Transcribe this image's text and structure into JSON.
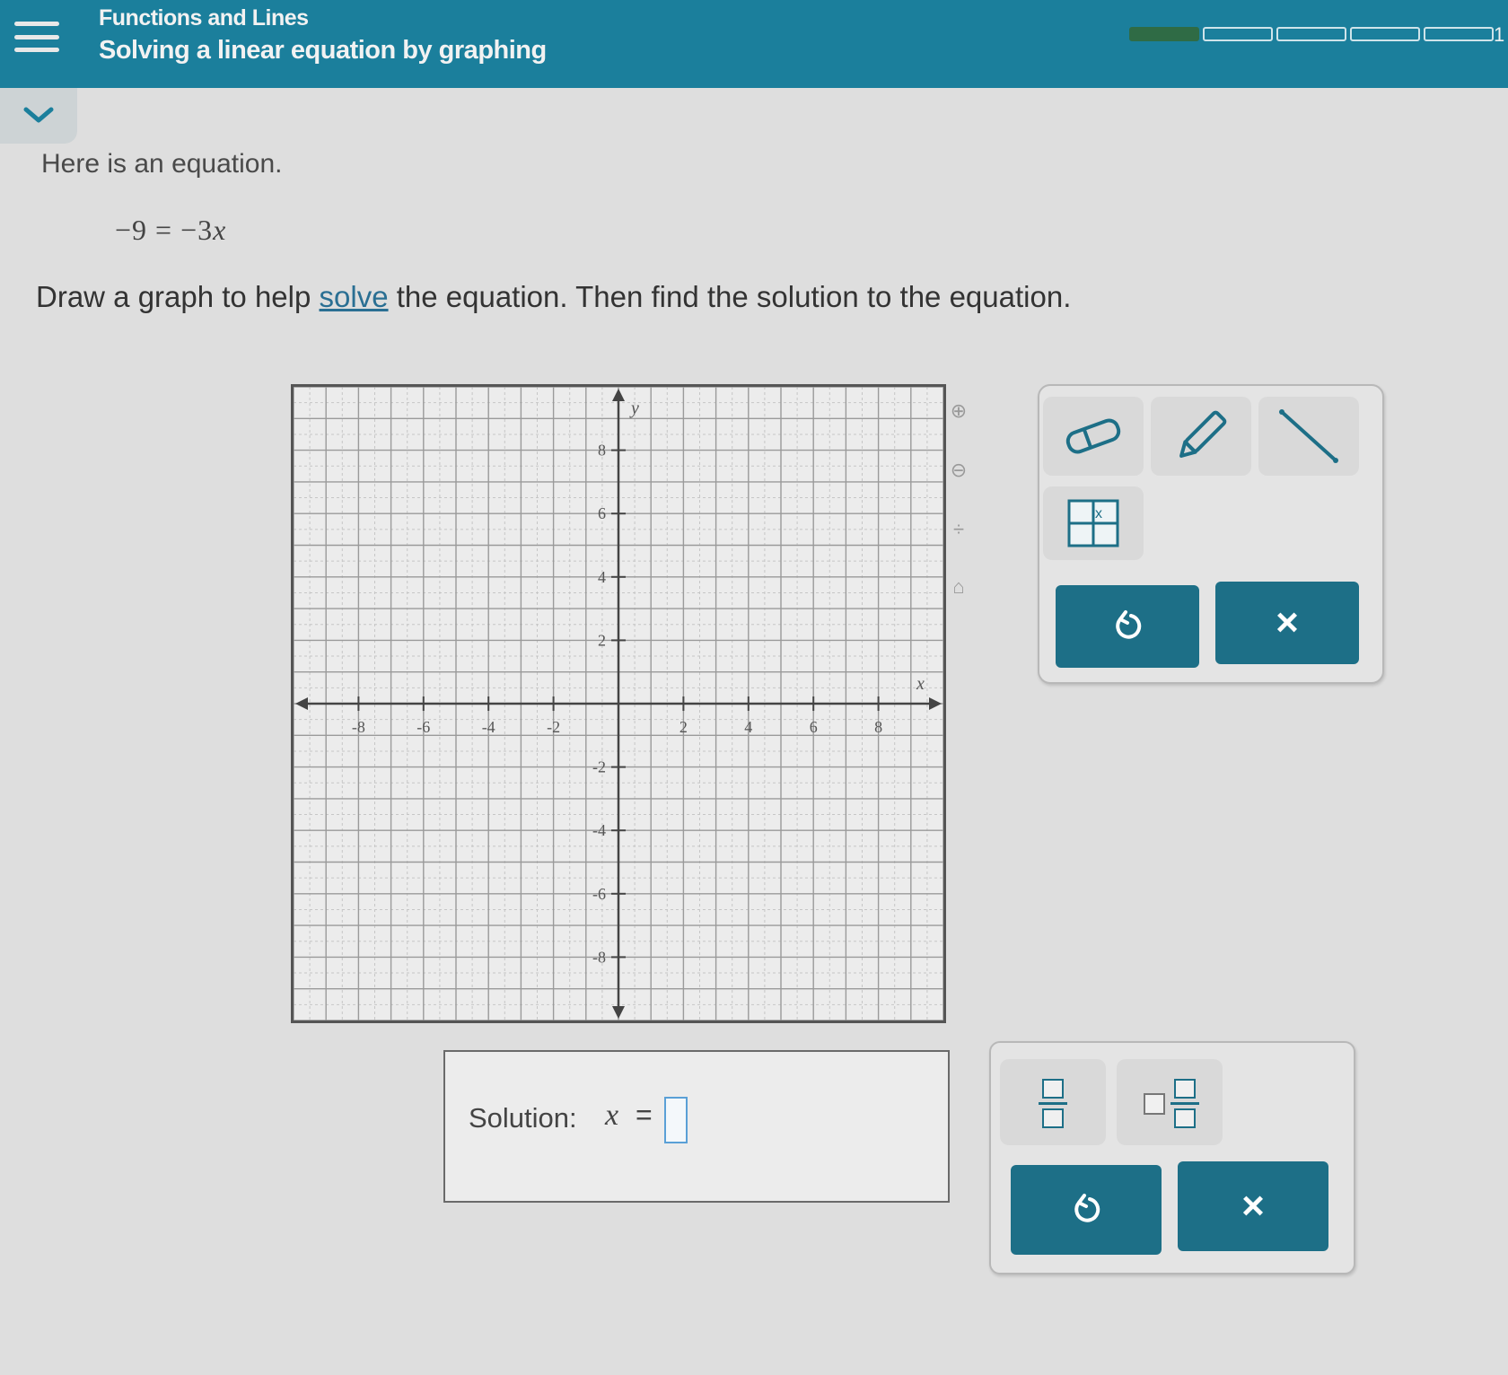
{
  "header": {
    "topic": "Functions and Lines",
    "lesson": "Solving a linear equation by graphing",
    "progress": {
      "segments": 5,
      "filled_fraction": 0.5
    },
    "progress_count": "1"
  },
  "problem": {
    "intro": "Here is an equation.",
    "equation": {
      "left": "−9",
      "equals": "=",
      "right_coef": "−3",
      "right_var": "x"
    },
    "instruction_before": "Draw a graph to help ",
    "instruction_link": "solve",
    "instruction_after": " the equation. Then find the solution to the equation."
  },
  "graph": {
    "x_label": "x",
    "y_label": "y",
    "x_ticks": [
      "-8",
      "-6",
      "-4",
      "-2",
      "2",
      "4",
      "6",
      "8"
    ],
    "y_ticks": [
      "8",
      "6",
      "4",
      "2",
      "-2",
      "-4",
      "-6",
      "-8"
    ],
    "range": [
      -10,
      10
    ]
  },
  "graph_tools": {
    "icons": [
      "zoom-in-icon",
      "zoom-out-icon",
      "fit-icon",
      "home-icon"
    ],
    "eraser": "eraser-icon",
    "pencil": "pencil-icon",
    "line": "line-segment-icon",
    "table": "table-icon",
    "undo": "undo-icon",
    "clear": "×"
  },
  "answer": {
    "label": "Solution:",
    "variable": "x",
    "equals": "=",
    "value": ""
  },
  "fraction_tools": {
    "fraction": "fraction-icon",
    "mixed": "mixed-number-icon",
    "undo": "undo-icon",
    "clear": "×"
  },
  "colors": {
    "header": "#1b7f9c",
    "button": "#1d6f87",
    "progress_fill": "#2f6b45",
    "link": "#2a6f93"
  }
}
